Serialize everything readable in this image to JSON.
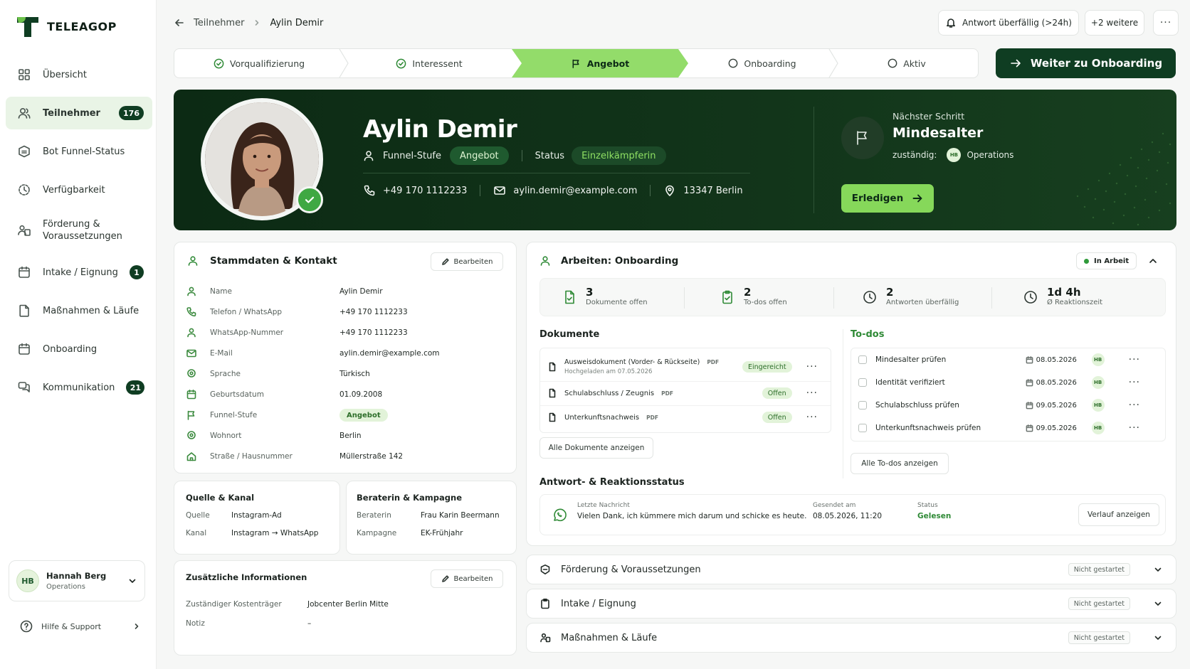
{
  "brand": {
    "name": "TELEAGOP",
    "accent": "#93dc6a",
    "dark": "#0f3d22"
  },
  "sidebar": {
    "items": [
      {
        "label": "Übersicht",
        "icon": "grid-icon"
      },
      {
        "label": "Teilnehmer",
        "icon": "users-icon",
        "badge": "176",
        "active": true
      },
      {
        "label": "Bot Funnel-Status",
        "icon": "bot-icon"
      },
      {
        "label": "Verfügbarkeit",
        "icon": "clock-icon"
      },
      {
        "label": "Förderung & Voraussetzungen",
        "icon": "people-icon"
      },
      {
        "label": "Intake / Eignung",
        "icon": "calendar-icon",
        "badge": "1"
      },
      {
        "label": "Maßnahmen & Läufe",
        "icon": "document-icon"
      },
      {
        "label": "Onboarding",
        "icon": "calendar-icon"
      },
      {
        "label": "Kommunikation",
        "icon": "chat-icon",
        "badge": "21"
      }
    ],
    "user": {
      "initials": "HB",
      "name": "Hannah Berg",
      "role": "Operations"
    },
    "help_label": "Hilfe & Support"
  },
  "header": {
    "breadcrumb": [
      "Teilnehmer",
      "Aylin Demir"
    ],
    "alert_label": "Antwort überfällig (>24h)",
    "more_label": "+2 weitere"
  },
  "stepper": {
    "steps": [
      {
        "label": "Vorqualifizierung",
        "state": "done"
      },
      {
        "label": "Interessent",
        "state": "done"
      },
      {
        "label": "Angebot",
        "state": "current"
      },
      {
        "label": "Onboarding",
        "state": "open"
      },
      {
        "label": "Aktiv",
        "state": "open"
      }
    ],
    "primary_label": "Weiter zu Onboarding"
  },
  "profile": {
    "name": "Aylin Demir",
    "funnel_label": "Funnel-Stufe",
    "funnel_value": "Angebot",
    "status_label": "Status",
    "status_value": "Einzelkämpferin",
    "phone": "+49 170 1112233",
    "email": "aylin.demir@example.com",
    "location": "13347 Berlin",
    "next_step_label": "Nächster Schritt",
    "next_step": "Mindesalter",
    "owner_label": "zuständig:",
    "owner_initials": "HB",
    "owner": "Operations",
    "done_label": "Erledigen"
  },
  "stammdaten": {
    "title": "Stammdaten & Kontakt",
    "edit_label": "Bearbeiten",
    "rows": [
      {
        "label": "Name",
        "value": "Aylin Demir",
        "icon": "user-icon"
      },
      {
        "label": "Telefon / WhatsApp",
        "value": "+49 170 1112233",
        "icon": "phone-icon"
      },
      {
        "label": "WhatsApp-Nummer",
        "value": "+49 170 1112233",
        "icon": "user-icon"
      },
      {
        "label": "E-Mail",
        "value": "aylin.demir@example.com",
        "icon": "mail-icon"
      },
      {
        "label": "Sprache",
        "value": "Türkisch",
        "icon": "pin-icon"
      },
      {
        "label": "Geburtsdatum",
        "value": "01.09.2008",
        "icon": "calendar-icon"
      },
      {
        "label": "Funnel-Stufe",
        "value": "Angebot",
        "icon": "flag-icon",
        "tag": true
      },
      {
        "label": "Wohnort",
        "value": "Berlin",
        "icon": "pin-icon"
      },
      {
        "label": "Straße / Hausnummer",
        "value": "Müllerstraße 142",
        "icon": "home-icon"
      }
    ]
  },
  "quelle": {
    "title": "Quelle & Kanal",
    "rows": [
      {
        "label": "Quelle",
        "value": "Instagram-Ad"
      },
      {
        "label": "Kanal",
        "value": "Instagram → WhatsApp"
      }
    ]
  },
  "beraterin": {
    "title": "Beraterin & Kampagne",
    "rows": [
      {
        "label": "Beraterin",
        "value": "Frau Karin Beermann"
      },
      {
        "label": "Kampagne",
        "value": "EK-Frühjahr"
      }
    ]
  },
  "zusatz": {
    "title": "Zusätzliche Informationen",
    "edit_label": "Bearbeiten",
    "rows": [
      {
        "label": "Zuständiger Kostenträger",
        "value": "Jobcenter Berlin Mitte"
      },
      {
        "label": "Notiz",
        "value": "–"
      }
    ]
  },
  "work": {
    "title": "Arbeiten: Onboarding",
    "state": "In Arbeit",
    "stats": [
      {
        "num": "3",
        "label": "Dokumente offen",
        "icon": "document-check-icon"
      },
      {
        "num": "2",
        "label": "To-dos offen",
        "icon": "clipboard-check-icon"
      },
      {
        "num": "2",
        "label": "Antworten überfällig",
        "icon": "clock-icon"
      },
      {
        "num": "1d 4h",
        "label": "Ø Reaktionszeit",
        "icon": "clock-icon"
      }
    ],
    "docs_title": "Dokumente",
    "docs": [
      {
        "name": "Ausweisdokument (Vorder- & Rückseite)",
        "type": "PDF",
        "sub": "Hochgeladen am 07.05.2026",
        "status": "Eingereicht"
      },
      {
        "name": "Schulabschluss / Zeugnis",
        "type": "PDF",
        "status": "Offen"
      },
      {
        "name": "Unterkunftsnachweis",
        "type": "PDF",
        "status": "Offen"
      }
    ],
    "docs_all": "Alle Dokumente anzeigen",
    "todos_title": "To-dos",
    "todos": [
      {
        "label": "Mindesalter prüfen",
        "date": "08.05.2026",
        "owner": "HB"
      },
      {
        "label": "Identität verifiziert",
        "date": "08.05.2026",
        "owner": "HB"
      },
      {
        "label": "Schulabschluss prüfen",
        "date": "09.05.2026",
        "owner": "HB"
      },
      {
        "label": "Unterkunftsnachweis prüfen",
        "date": "09.05.2026",
        "owner": "HB"
      }
    ],
    "todos_all": "Alle To-dos anzeigen",
    "reply_title": "Antwort- & Reaktionsstatus",
    "reply": {
      "last_label": "Letzte Nachricht",
      "last_text": "Vielen Dank, ich kümmere mich darum und schicke es heute.",
      "sent_label": "Gesendet am",
      "sent_value": "08.05.2026, 11:20",
      "status_label": "Status",
      "status_value": "Gelesen",
      "history_label": "Verlauf anzeigen"
    }
  },
  "accordions": [
    {
      "label": "Förderung & Voraussetzungen",
      "status": "Nicht gestartet",
      "icon": "shield-icon"
    },
    {
      "label": "Intake / Eignung",
      "status": "Nicht gestartet",
      "icon": "clipboard-icon"
    },
    {
      "label": "Maßnahmen & Läufe",
      "status": "Nicht gestartet",
      "icon": "people-icon"
    }
  ]
}
